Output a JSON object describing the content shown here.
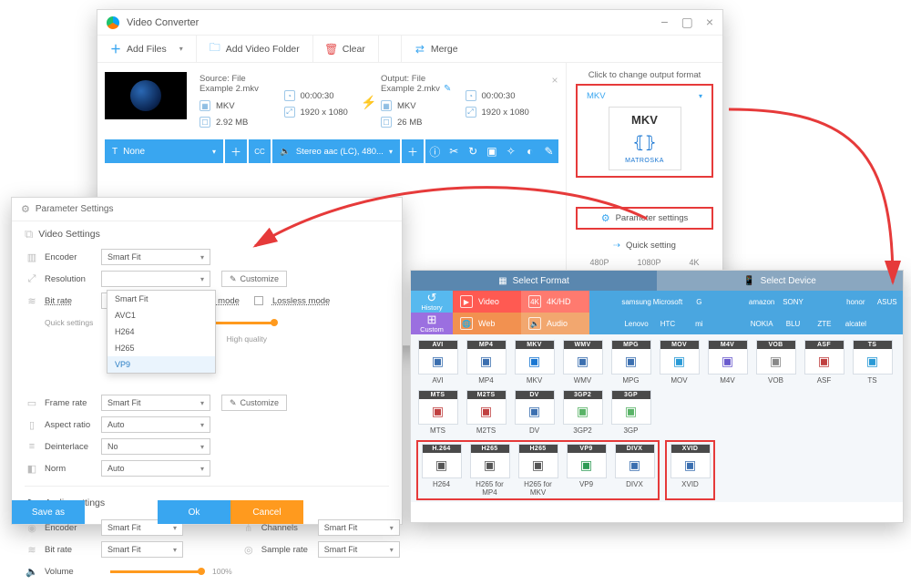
{
  "vc": {
    "title": "Video Converter",
    "toolbar": {
      "addFiles": "Add Files",
      "addFolder": "Add Video Folder",
      "clear": "Clear",
      "merge": "Merge"
    },
    "source": {
      "label": "Source: File Example  2.mkv",
      "format": "MKV",
      "duration": "00:00:30",
      "size": "2.92 MB",
      "resolution": "1920 x 1080"
    },
    "output": {
      "label": "Output: File Example  2.mkv",
      "format": "MKV",
      "duration": "00:00:30",
      "size": "26 MB",
      "resolution": "1920 x 1080"
    },
    "strip": {
      "none": "None",
      "audio": "Stereo aac (LC), 480..."
    },
    "right": {
      "hdr": "Click to change output format",
      "fmtName": "MKV",
      "mkv": "MKV",
      "matroska": "MATROSKA",
      "param": "Parameter settings",
      "quick": "Quick setting",
      "q1": "480P",
      "q2": "1080P",
      "q3": "4K"
    }
  },
  "ps": {
    "title": "Parameter Settings",
    "video": {
      "hdr": "Video Settings",
      "encoder": "Encoder",
      "encVal": "Smart Fit",
      "resolution": "Resolution",
      "customize": "Customize",
      "bitrate": "Bit rate",
      "vbr": "VBR mode",
      "lossless": "Lossless mode",
      "quickSettings": "Quick settings",
      "quality": "High quality",
      "frame": "Frame rate",
      "aspect": "Aspect ratio",
      "deint": "Deinterlace",
      "denoise": "Norm",
      "frameVal": "Smart Fit",
      "aspectVal": "Auto",
      "deintVal": "No",
      "denoiseVal": "Auto",
      "ddSmart": "Smart Fit",
      "ddAVC1": "AVC1",
      "ddH264": "H264",
      "ddH265": "H265",
      "ddVP9": "VP9"
    },
    "audio": {
      "hdr": "Audio settings",
      "enc": "Encoder",
      "encV": "Smart Fit",
      "br": "Bit rate",
      "brV": "Smart Fit",
      "vol": "Volume",
      "volPct": "100%",
      "ch": "Channels",
      "chV": "Smart Fit",
      "sr": "Sample rate",
      "srV": "Smart Fit"
    },
    "footer": {
      "save": "Save as",
      "ok": "Ok",
      "cancel": "Cancel"
    }
  },
  "fp": {
    "tab1": "Select Format",
    "tab2": "Select Device",
    "catLeft": {
      "history": "History",
      "custom": "Custom"
    },
    "cats": {
      "video": "Video",
      "hd": "4K/HD",
      "web": "Web",
      "audio": "Audio"
    },
    "brands": [
      "",
      "samsung",
      "Microsoft",
      "G",
      "",
      "amazon",
      "SONY",
      "",
      "honor",
      "ASUS",
      "",
      "Lenovo",
      "HTC",
      "mi",
      "",
      "NOKIA",
      "BLU",
      "ZTE",
      "alcatel",
      ""
    ],
    "row1": [
      {
        "h": "AVI",
        "cap": "AVI",
        "c": "#3b6fb0"
      },
      {
        "h": "MP4",
        "cap": "MP4",
        "c": "#3b6fb0"
      },
      {
        "h": "MKV",
        "cap": "MKV",
        "c": "#1976d2"
      },
      {
        "h": "WMV",
        "cap": "WMV",
        "c": "#3b6fb0"
      },
      {
        "h": "MPG",
        "cap": "MPG",
        "c": "#3b6fb0"
      },
      {
        "h": "MOV",
        "cap": "MOV",
        "c": "#2a9ad6"
      },
      {
        "h": "M4V",
        "cap": "M4V",
        "c": "#6a5acd"
      },
      {
        "h": "VOB",
        "cap": "VOB",
        "c": "#888"
      },
      {
        "h": "ASF",
        "cap": "ASF",
        "c": "#c04040"
      },
      {
        "h": "TS",
        "cap": "TS",
        "c": "#2a9ad6"
      }
    ],
    "row2a": [
      {
        "h": "MTS",
        "cap": "MTS",
        "c": "#c04040"
      },
      {
        "h": "M2TS",
        "cap": "M2TS",
        "c": "#c04040"
      },
      {
        "h": "DV",
        "cap": "DV",
        "c": "#3b6fb0"
      },
      {
        "h": "3GP2",
        "cap": "3GP2",
        "c": "#59b367"
      },
      {
        "h": "3GP",
        "cap": "3GP",
        "c": "#59b367"
      }
    ],
    "row2b": [
      {
        "h": "H.264",
        "cap": "H264",
        "c": "#555"
      },
      {
        "h": "H265",
        "cap": "H265 for MP4",
        "c": "#555"
      },
      {
        "h": "H265",
        "cap": "H265 for MKV",
        "c": "#555"
      },
      {
        "h": "VP9",
        "cap": "VP9",
        "c": "#2e9b55"
      },
      {
        "h": "DIVX",
        "cap": "DIVX",
        "c": "#3b6fb0"
      }
    ],
    "row3": [
      {
        "h": "XVID",
        "cap": "XVID",
        "c": "#3b6fb0"
      }
    ]
  }
}
